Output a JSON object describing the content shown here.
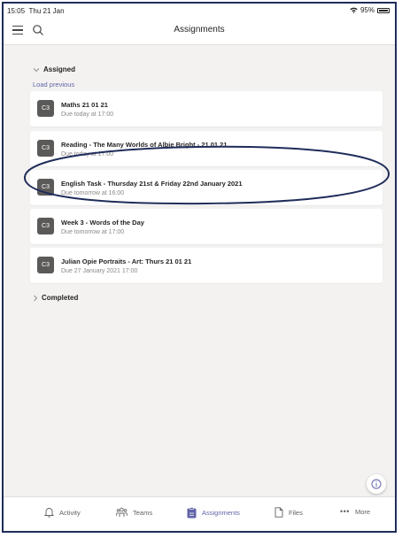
{
  "status_bar": {
    "time": "15:05",
    "date": "Thu 21 Jan",
    "battery": "95%",
    "battery_level": 0.95
  },
  "header": {
    "title": "Assignments",
    "menu_icon": "hamburger-menu-icon",
    "search_icon": "search-icon"
  },
  "assigned_section": {
    "label": "Assigned",
    "load_previous": "Load previous"
  },
  "assignments": [
    {
      "badge": "C3",
      "title": "Maths 21 01 21",
      "due": "Due today at 17:00"
    },
    {
      "badge": "C3",
      "title": "Reading - The Many Worlds of Albie Bright - 21 01 21",
      "due": "Due today at 17:00"
    },
    {
      "badge": "C3",
      "title": "English Task - Thursday 21st & Friday 22nd January 2021",
      "due": "Due tomorrow at 16:00"
    },
    {
      "badge": "C3",
      "title": "Week 3 - Words of the Day",
      "due": "Due tomorrow at 17:00"
    },
    {
      "badge": "C3",
      "title": "Julian Opie Portraits - Art: Thurs 21 01 21",
      "due": "Due 27 January 2021 17:00"
    }
  ],
  "completed_section": {
    "label": "Completed"
  },
  "tabs": [
    {
      "label": "Activity",
      "icon": "bell-icon",
      "active": false
    },
    {
      "label": "Teams",
      "icon": "teams-icon",
      "active": false
    },
    {
      "label": "Assignments",
      "icon": "assignments-icon",
      "active": true
    },
    {
      "label": "Files",
      "icon": "file-icon",
      "active": false
    },
    {
      "label": "More",
      "icon": "more-dots-icon",
      "active": false
    }
  ],
  "colors": {
    "accent": "#6264a7",
    "badge": "#5b5a59",
    "annotation": "#1f2d5a",
    "background": "#f3f2f1"
  }
}
